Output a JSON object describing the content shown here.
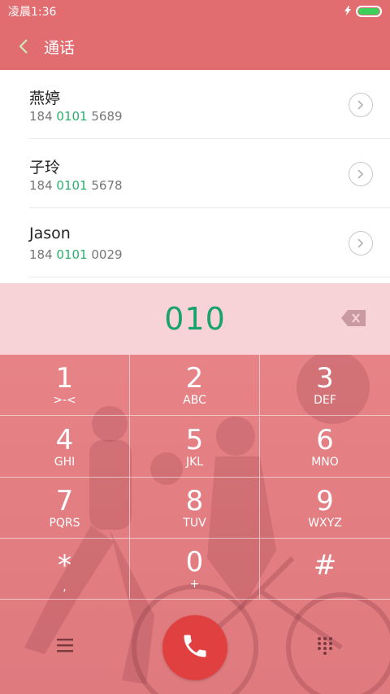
{
  "status_bar": {
    "time": "凌晨1:36",
    "battery_level": 1.0
  },
  "header": {
    "title": "通话"
  },
  "contacts": [
    {
      "name": "燕婷",
      "number_prefix": "184 ",
      "number_match": "0101",
      "number_suffix": " 5689"
    },
    {
      "name": "子玲",
      "number_prefix": "184 ",
      "number_match": "0101",
      "number_suffix": " 5678"
    },
    {
      "name": "Jason",
      "number_prefix": "184 ",
      "number_match": "0101",
      "number_suffix": " 0029"
    }
  ],
  "dialer": {
    "input": "010",
    "keys": [
      {
        "digit": "1",
        "letters": ">-<"
      },
      {
        "digit": "2",
        "letters": "ABC"
      },
      {
        "digit": "3",
        "letters": "DEF"
      },
      {
        "digit": "4",
        "letters": "GHI"
      },
      {
        "digit": "5",
        "letters": "JKL"
      },
      {
        "digit": "6",
        "letters": "MNO"
      },
      {
        "digit": "7",
        "letters": "PQRS"
      },
      {
        "digit": "8",
        "letters": "TUV"
      },
      {
        "digit": "9",
        "letters": "WXYZ"
      },
      {
        "digit": "*",
        "letters": ","
      },
      {
        "digit": "0",
        "letters": "+"
      },
      {
        "digit": "#",
        "letters": ""
      }
    ]
  },
  "colors": {
    "accent": "#e26d71",
    "match": "#2ab06a",
    "call": "#e0403f"
  },
  "icons": [
    "back-chevron-icon",
    "chevron-right-icon",
    "backspace-icon",
    "menu-icon",
    "phone-icon",
    "dialpad-icon"
  ]
}
